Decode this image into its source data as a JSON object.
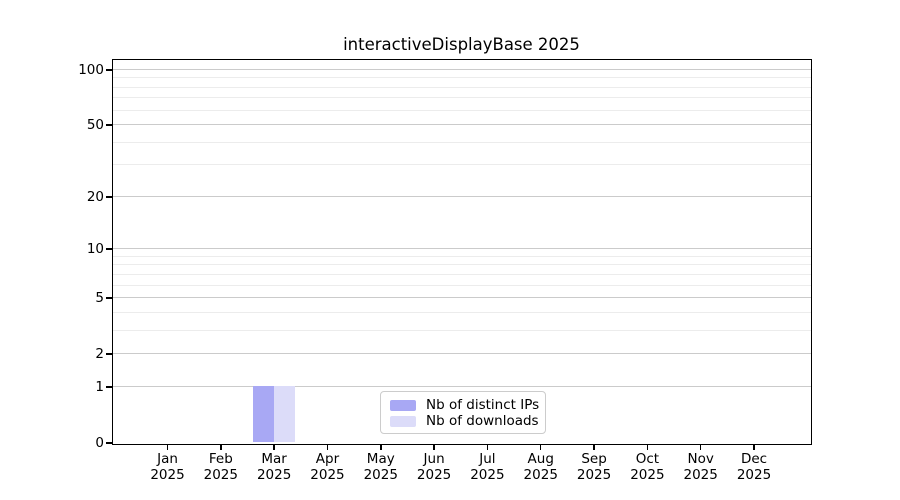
{
  "title": "interactiveDisplayBase 2025",
  "chart_data": {
    "type": "bar",
    "title": "interactiveDisplayBase 2025",
    "categories": [
      "Jan",
      "Feb",
      "Mar",
      "Apr",
      "May",
      "Jun",
      "Jul",
      "Aug",
      "Sep",
      "Oct",
      "Nov",
      "Dec"
    ],
    "year": "2025",
    "series": [
      {
        "name": "Nb of distinct IPs",
        "color": "#a8a8f4",
        "values": [
          0,
          0,
          1,
          0,
          0,
          0,
          0,
          0,
          0,
          0,
          0,
          0
        ]
      },
      {
        "name": "Nb of downloads",
        "color": "#dcdcf9",
        "values": [
          0,
          0,
          1,
          0,
          0,
          0,
          0,
          0,
          0,
          0,
          0,
          0
        ]
      }
    ],
    "xlabel": "",
    "ylabel": "",
    "yaxis": {
      "scale": "log10(1+x)",
      "ticks": [
        0,
        1,
        2,
        5,
        10,
        20,
        50,
        100
      ],
      "tick_labels": [
        "0",
        "1",
        "2",
        "5",
        "10",
        "20",
        "50",
        "100"
      ],
      "minor_gridlines": [
        3,
        4,
        6,
        7,
        8,
        9,
        30,
        40,
        60,
        70,
        80,
        90
      ],
      "ylim": [
        0,
        113
      ]
    },
    "grid": true,
    "legend_position": "lower center"
  },
  "colors": {
    "background": "#ffffff",
    "spine": "#000000",
    "text": "#000000",
    "major_grid": "#cbcbcb",
    "minor_grid": "#ececec",
    "bar_distinct_ips": "#a8a8f4",
    "bar_downloads": "#dcdcf9",
    "legend_border": "#cccccc"
  }
}
